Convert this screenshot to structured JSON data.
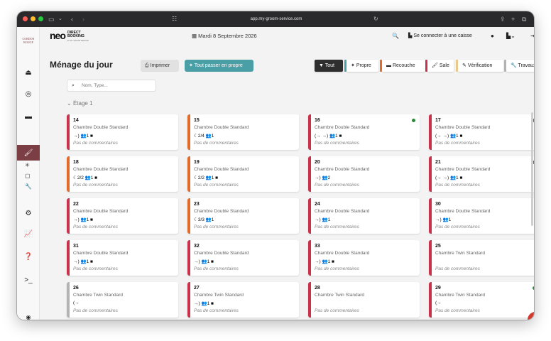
{
  "browser": {
    "url": "app.my-groom-service.com"
  },
  "sidebar": {
    "logo_text": "CORDON ROUGE"
  },
  "header": {
    "brand": "neo",
    "brand_tag_1": "DIRECT",
    "brand_tag_2": "BOOKING",
    "brand_sub": "BY MY GROOM SERVICE",
    "date": "Mardi 8 Septembre 2026",
    "caisse": "Se connecter à une caisse"
  },
  "page": {
    "title": "Ménage du jour",
    "print_label": "Imprimer",
    "clean_all_label": "Tout passer en propre",
    "search_placeholder": "Nom, Type...",
    "floor_label": "Étage 1"
  },
  "filters": [
    {
      "label": "Tout",
      "color": "#2e2e2e"
    },
    {
      "label": "Propre",
      "color": "#4a9fa6"
    },
    {
      "label": "Recouche",
      "color": "#e06b2a"
    },
    {
      "label": "Sale",
      "color": "#c8324a"
    },
    {
      "label": "Vérification",
      "color": "#e8c98a"
    },
    {
      "label": "Travaux",
      "color": "#b3b3b3"
    }
  ],
  "rooms": [
    {
      "number": "14",
      "type": "Chambre Double Standard",
      "icons": "→) 👥1 ■",
      "comment": "Pas de commentaires",
      "color": "#c8324a",
      "dot": false
    },
    {
      "number": "15",
      "type": "Chambre Double Standard",
      "icons": "☾2/4 👥1",
      "comment": "Pas de commentaires",
      "color": "#e06b2a",
      "dot": false
    },
    {
      "number": "16",
      "type": "Chambre Double Standard",
      "icons": "(→ →) 👥1 ■",
      "comment": "Pas de commentaires",
      "color": "#c8324a",
      "dot": true
    },
    {
      "number": "17",
      "type": "Chambre Double Standard",
      "icons": "(→ →) 👥1 ■",
      "comment": "Pas de commentaires",
      "color": "#c8324a",
      "dot": true
    },
    {
      "number": "18",
      "type": "Chambre Double Standard",
      "icons": "☾2/2 👥1 ■",
      "comment": "Pas de commentaires",
      "color": "#e06b2a",
      "dot": false
    },
    {
      "number": "19",
      "type": "Chambre Double Standard",
      "icons": "☾2/2 👥1 ■",
      "comment": "Pas de commentaires",
      "color": "#e06b2a",
      "dot": false
    },
    {
      "number": "20",
      "type": "Chambre Double Standard",
      "icons": "→) 👥2",
      "comment": "Pas de commentaires",
      "color": "#c8324a",
      "dot": false
    },
    {
      "number": "21",
      "type": "Chambre Double Standard",
      "icons": "(→ →) 👥1 ■",
      "comment": "Pas de commentaires",
      "color": "#c8324a",
      "dot": true
    },
    {
      "number": "22",
      "type": "Chambre Double Standard",
      "icons": "→) 👥1 ■",
      "comment": "Pas de commentaires",
      "color": "#c8324a",
      "dot": false
    },
    {
      "number": "23",
      "type": "Chambre Double Standard",
      "icons": "☾3/3 👥1",
      "comment": "Pas de commentaires",
      "color": "#e06b2a",
      "dot": false
    },
    {
      "number": "24",
      "type": "Chambre Double Standard",
      "icons": "→) 👥1",
      "comment": "Pas de commentaires",
      "color": "#c8324a",
      "dot": false
    },
    {
      "number": "30",
      "type": "Chambre Double Standard",
      "icons": "→) 👥1",
      "comment": "Pas de commentaires",
      "color": "#c8324a",
      "dot": false
    },
    {
      "number": "31",
      "type": "Chambre Double Standard",
      "icons": "→) 👥1 ■",
      "comment": "Pas de commentaires",
      "color": "#c8324a",
      "dot": false
    },
    {
      "number": "32",
      "type": "Chambre Double Standard",
      "icons": "→) 👥1 ■",
      "comment": "Pas de commentaires",
      "color": "#c8324a",
      "dot": false
    },
    {
      "number": "33",
      "type": "Chambre Double Standard",
      "icons": "→) 👥1 ■",
      "comment": "Pas de commentaires",
      "color": "#c8324a",
      "dot": false
    },
    {
      "number": "25",
      "type": "Chambre Twin Standard",
      "icons": "",
      "comment": "Pas de commentaires",
      "color": "#c8324a",
      "dot": false
    },
    {
      "number": "26",
      "type": "Chambre Twin Standard",
      "icons": "(→",
      "comment": "Pas de commentaires",
      "color": "#b3b3b3",
      "dot": false
    },
    {
      "number": "27",
      "type": "Chambre Twin Standard",
      "icons": "→) 👥1 ■",
      "comment": "Pas de commentaires",
      "color": "#c8324a",
      "dot": false
    },
    {
      "number": "28",
      "type": "Chambre Twin Standard",
      "icons": "",
      "comment": "Pas de commentaires",
      "color": "#c8324a",
      "dot": false
    },
    {
      "number": "29",
      "type": "Chambre Twin Standard",
      "icons": "(→",
      "comment": "Pas de commentaires",
      "color": "#c8324a",
      "dot": true
    }
  ]
}
